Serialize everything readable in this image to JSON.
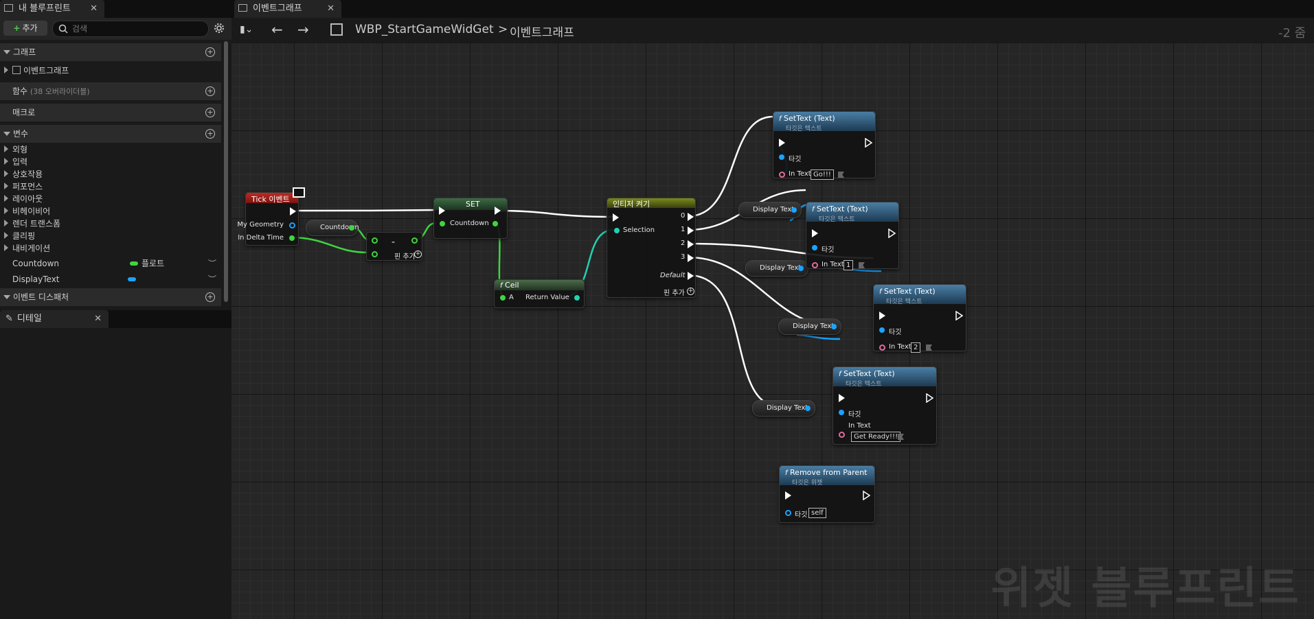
{
  "left_tabs": {
    "blueprint_tab": "내 블루프린트",
    "close": "✕"
  },
  "toolbar": {
    "add_label": "추가",
    "search_placeholder": "검색"
  },
  "sections": {
    "graph": "그래프",
    "graph_item": "이벤트그래프",
    "functions": "함수",
    "functions_note": "(38 오버라이더블)",
    "macros": "매크로",
    "variables": "변수",
    "categories": [
      "외형",
      "입력",
      "상호작용",
      "퍼포먼스",
      "레이아웃",
      "비헤이비어",
      "렌더 트랜스폼",
      "클리핑",
      "내비게이션"
    ],
    "var_countdown": "Countdown",
    "var_countdown_type": "플로트",
    "var_displaytext": "DisplayText",
    "dispatchers": "이벤트 디스패처"
  },
  "details_tab": "디테일",
  "graph_tab": "이벤트그래프",
  "breadcrumb": {
    "blueprint": "WBP_StartGameWidGet",
    "separator": ">",
    "graph": "이벤트그래프"
  },
  "zoom": "-2 줌",
  "watermark": "위젯 블루프린트",
  "colors": {
    "float_pin": "#3fd53f",
    "text_pin": "#e06c9f",
    "object_pin": "#1aa3ff",
    "event_header": "#a8201a",
    "function_header": "#3b6c8e",
    "switch_header": "#6f7a1a",
    "set_header": "#2f5a3a"
  },
  "nodes": {
    "tick": {
      "title": "Tick 이벤트",
      "my_geometry": "My Geometry",
      "in_delta_time": "In Delta Time"
    },
    "countdown_get": "Countdown",
    "subtract": {
      "symbol": "-",
      "add_pin": "핀 추가"
    },
    "set": {
      "title": "SET",
      "pin": "Countdown"
    },
    "ceil": {
      "title": "Ceil",
      "a": "A",
      "return_value": "Return Value"
    },
    "switch": {
      "title": "인티저 켜기",
      "selection": "Selection",
      "outputs": [
        "0",
        "1",
        "2",
        "3"
      ],
      "default": "Default",
      "add_pin": "핀 추가"
    },
    "settext_sub": "타깃은 텍스트",
    "settext0": {
      "title": "SetText (Text)",
      "target": "타깃",
      "in_text": "In Text",
      "value": "Go!!!"
    },
    "settext1": {
      "title": "SetText (Text)",
      "target": "타깃",
      "in_text": "In Text",
      "value": "1"
    },
    "settext2": {
      "title": "SetText (Text)",
      "target": "타깃",
      "in_text": "In Text",
      "value": "2"
    },
    "settext3": {
      "title": "SetText (Text)",
      "target": "타깃",
      "in_text": "In Text",
      "value": "Get Ready!!!"
    },
    "display_text": "Display Text",
    "remove": {
      "title": "Remove from Parent",
      "sub": "타깃은 위젯",
      "target": "타깃",
      "value": "self"
    }
  }
}
